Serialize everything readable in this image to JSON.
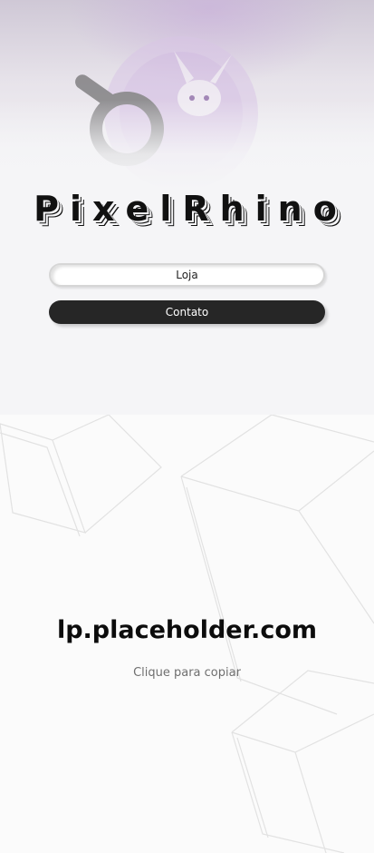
{
  "hero": {
    "brand": "PixelRhino",
    "buttons": {
      "loja": "Loja",
      "contato": "Contato"
    }
  },
  "domain": {
    "address": "lp.placeholder.com",
    "hint": "Clique para copiar"
  },
  "colors": {
    "dark_button": "#262626",
    "light_button": "#ffffff",
    "hero_bg": "#f5f5f7",
    "lower_bg": "#fbfbfb",
    "accent_purple": "#c8aadc"
  }
}
